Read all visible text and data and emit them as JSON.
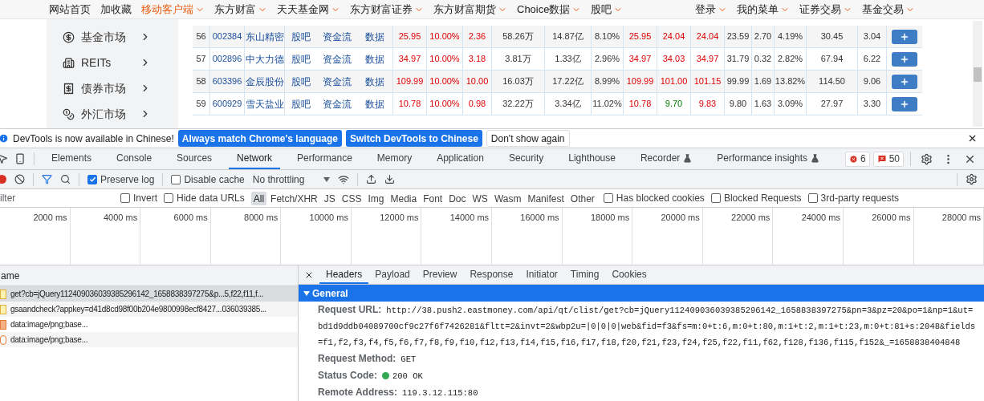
{
  "site_nav": {
    "left": [
      {
        "label": "网站首页",
        "caret": false,
        "highlighted": false
      },
      {
        "label": "加收藏",
        "caret": false,
        "highlighted": false
      },
      {
        "label": "移动客户端",
        "caret": true,
        "highlighted": true
      },
      {
        "label": "东方财富",
        "caret": true,
        "highlighted": false
      },
      {
        "label": "天天基金网",
        "caret": true,
        "highlighted": false
      },
      {
        "label": "东方财富证券",
        "caret": true,
        "highlighted": false
      },
      {
        "label": "东方财富期货",
        "caret": true,
        "highlighted": false
      },
      {
        "label": "Choice数据",
        "caret": true,
        "highlighted": false
      },
      {
        "label": "股吧",
        "caret": true,
        "highlighted": false
      }
    ],
    "right": [
      {
        "label": "登录",
        "caret": true,
        "highlighted": false
      },
      {
        "label": "我的菜单",
        "caret": true,
        "highlighted": false
      },
      {
        "label": "证券交易",
        "caret": true,
        "highlighted": false
      },
      {
        "label": "基金交易",
        "caret": true,
        "highlighted": false
      }
    ]
  },
  "sidebar": {
    "items": [
      {
        "label": "基金市场",
        "kind": "fund"
      },
      {
        "label": "REITs",
        "kind": "building"
      },
      {
        "label": "债券市场",
        "kind": "bond"
      },
      {
        "label": "外汇市场",
        "kind": "forex"
      }
    ]
  },
  "stock_table": {
    "rows": [
      {
        "index": "56",
        "code": "002384",
        "name": "东山精密",
        "links": [
          "股吧",
          "资金流",
          "数据"
        ],
        "cells": [
          {
            "text": "25.95",
            "up": true,
            "down": false
          },
          {
            "text": "10.00%",
            "up": true,
            "down": false
          },
          {
            "text": "2.36",
            "up": true,
            "down": false
          },
          {
            "text": "58.26万",
            "up": false,
            "down": false
          },
          {
            "text": "14.87亿",
            "up": false,
            "down": false
          },
          {
            "text": "8.10%",
            "up": false,
            "down": false
          },
          {
            "text": "25.95",
            "up": true,
            "down": false
          },
          {
            "text": "24.04",
            "up": true,
            "down": false
          },
          {
            "text": "24.04",
            "up": true,
            "down": false
          },
          {
            "text": "23.59",
            "up": false,
            "down": false
          },
          {
            "text": "2.70",
            "up": false,
            "down": false
          },
          {
            "text": "4.19%",
            "up": false,
            "down": false
          },
          {
            "text": "30.45",
            "up": false,
            "down": false
          },
          {
            "text": "3.04",
            "up": false,
            "down": false
          }
        ]
      },
      {
        "index": "57",
        "code": "002896",
        "name": "中大力德",
        "links": [
          "股吧",
          "资金流",
          "数据"
        ],
        "cells": [
          {
            "text": "34.97",
            "up": true,
            "down": false
          },
          {
            "text": "10.00%",
            "up": true,
            "down": false
          },
          {
            "text": "3.18",
            "up": true,
            "down": false
          },
          {
            "text": "3.81万",
            "up": false,
            "down": false
          },
          {
            "text": "1.33亿",
            "up": false,
            "down": false
          },
          {
            "text": "2.96%",
            "up": false,
            "down": false
          },
          {
            "text": "34.97",
            "up": true,
            "down": false
          },
          {
            "text": "34.03",
            "up": true,
            "down": false
          },
          {
            "text": "34.97",
            "up": true,
            "down": false
          },
          {
            "text": "31.79",
            "up": false,
            "down": false
          },
          {
            "text": "0.32",
            "up": false,
            "down": false
          },
          {
            "text": "2.82%",
            "up": false,
            "down": false
          },
          {
            "text": "67.94",
            "up": false,
            "down": false
          },
          {
            "text": "6.22",
            "up": false,
            "down": false
          }
        ]
      },
      {
        "index": "58",
        "code": "603396",
        "name": "金辰股份",
        "links": [
          "股吧",
          "资金流",
          "数据"
        ],
        "cells": [
          {
            "text": "109.99",
            "up": true,
            "down": false
          },
          {
            "text": "10.00%",
            "up": true,
            "down": false
          },
          {
            "text": "10.00",
            "up": true,
            "down": false
          },
          {
            "text": "16.03万",
            "up": false,
            "down": false
          },
          {
            "text": "17.22亿",
            "up": false,
            "down": false
          },
          {
            "text": "8.99%",
            "up": false,
            "down": false
          },
          {
            "text": "109.99",
            "up": true,
            "down": false
          },
          {
            "text": "101.00",
            "up": true,
            "down": false
          },
          {
            "text": "101.15",
            "up": true,
            "down": false
          },
          {
            "text": "99.99",
            "up": false,
            "down": false
          },
          {
            "text": "1.69",
            "up": false,
            "down": false
          },
          {
            "text": "13.82%",
            "up": false,
            "down": false
          },
          {
            "text": "114.50",
            "up": false,
            "down": false
          },
          {
            "text": "9.06",
            "up": false,
            "down": false
          }
        ]
      },
      {
        "index": "59",
        "code": "600929",
        "name": "雪天盐业",
        "links": [
          "股吧",
          "资金流",
          "数据"
        ],
        "cells": [
          {
            "text": "10.78",
            "up": true,
            "down": false
          },
          {
            "text": "10.00%",
            "up": true,
            "down": false
          },
          {
            "text": "0.98",
            "up": true,
            "down": false
          },
          {
            "text": "32.22万",
            "up": false,
            "down": false
          },
          {
            "text": "3.34亿",
            "up": false,
            "down": false
          },
          {
            "text": "11.02%",
            "up": false,
            "down": false
          },
          {
            "text": "10.78",
            "up": true,
            "down": false
          },
          {
            "text": "9.70",
            "up": false,
            "down": true
          },
          {
            "text": "9.83",
            "up": true,
            "down": false
          },
          {
            "text": "9.80",
            "up": false,
            "down": false
          },
          {
            "text": "1.63",
            "up": false,
            "down": false
          },
          {
            "text": "3.09%",
            "up": false,
            "down": false
          },
          {
            "text": "27.97",
            "up": false,
            "down": false
          },
          {
            "text": "3.30",
            "up": false,
            "down": false
          }
        ]
      }
    ]
  },
  "infobar": {
    "message": "DevTools is now available in Chinese!",
    "buttons": [
      {
        "label": "Always match Chrome's language",
        "kind": "primary"
      },
      {
        "label": "Switch DevTools to Chinese",
        "kind": "primary"
      },
      {
        "label": "Don't show again",
        "kind": "secondary"
      }
    ]
  },
  "devtools_tabs": [
    {
      "label": "Elements",
      "selected": false,
      "experimental": false
    },
    {
      "label": "Console",
      "selected": false,
      "experimental": false
    },
    {
      "label": "Sources",
      "selected": false,
      "experimental": false
    },
    {
      "label": "Network",
      "selected": true,
      "experimental": false
    },
    {
      "label": "Performance",
      "selected": false,
      "experimental": false
    },
    {
      "label": "Memory",
      "selected": false,
      "experimental": false
    },
    {
      "label": "Application",
      "selected": false,
      "experimental": false
    },
    {
      "label": "Security",
      "selected": false,
      "experimental": false
    },
    {
      "label": "Lighthouse",
      "selected": false,
      "experimental": false
    },
    {
      "label": "Recorder",
      "selected": false,
      "experimental": true
    },
    {
      "label": "Performance insights",
      "selected": false,
      "experimental": true
    }
  ],
  "issue_counts": {
    "errors": "6",
    "warnings": "50"
  },
  "network_toolbar": {
    "preserve_log": {
      "label": "Preserve log",
      "checked": true
    },
    "disable_cache": {
      "label": "Disable cache",
      "checked": false
    },
    "throttling": "No throttling"
  },
  "filter_bar": {
    "placeholder": "ilter",
    "options_left": [
      {
        "label": "Invert",
        "checked": false
      },
      {
        "label": "Hide data URLs",
        "checked": false
      }
    ],
    "types": [
      {
        "label": "All",
        "selected": true
      },
      {
        "label": "Fetch/XHR",
        "selected": false
      },
      {
        "label": "JS",
        "selected": false
      },
      {
        "label": "CSS",
        "selected": false
      },
      {
        "label": "Img",
        "selected": false
      },
      {
        "label": "Media",
        "selected": false
      },
      {
        "label": "Font",
        "selected": false
      },
      {
        "label": "Doc",
        "selected": false
      },
      {
        "label": "WS",
        "selected": false
      },
      {
        "label": "Wasm",
        "selected": false
      },
      {
        "label": "Manifest",
        "selected": false
      },
      {
        "label": "Other",
        "selected": false
      }
    ],
    "options_right": [
      {
        "label": "Has blocked cookies",
        "checked": false
      },
      {
        "label": "Blocked Requests",
        "checked": false
      },
      {
        "label": "3rd-party requests",
        "checked": false
      }
    ]
  },
  "timeline": {
    "ticks": [
      "2000 ms",
      "4000 ms",
      "6000 ms",
      "8000 ms",
      "10000 ms",
      "12000 ms",
      "14000 ms",
      "16000 ms",
      "18000 ms",
      "20000 ms",
      "22000 ms",
      "24000 ms",
      "26000 ms",
      "28000 ms"
    ]
  },
  "requests": {
    "column": "ame",
    "rows": [
      {
        "name": "get?cb=jQuery112409036039385296142_1658838397275&p...5,f22,f11,f...",
        "kind": "script",
        "selected": true
      },
      {
        "name": "gsaandcheck?appkey=d41d8cd98f00b204e9800998ecf8427...036039385...",
        "kind": "script",
        "selected": false
      },
      {
        "name": "data:image/png;base...",
        "kind": "image",
        "selected": false
      },
      {
        "name": "data:image/png;base...",
        "kind": "svg",
        "selected": false
      }
    ]
  },
  "details": {
    "tabs": [
      {
        "label": "Headers",
        "selected": true
      },
      {
        "label": "Payload",
        "selected": false
      },
      {
        "label": "Preview",
        "selected": false
      },
      {
        "label": "Response",
        "selected": false
      },
      {
        "label": "Initiator",
        "selected": false
      },
      {
        "label": "Timing",
        "selected": false
      },
      {
        "label": "Cookies",
        "selected": false
      }
    ],
    "section": {
      "title": "General",
      "expanded": true,
      "rows": [
        {
          "key": "Request URL:",
          "value": "http://38.push2.eastmoney.com/api/qt/clist/get?cb=jQuery112409036039385296142_1658838397275&pn=3&pz=20&po=1&np=1&ut=bd1d9ddb04089700cf9c27f6f7426281&fltt=2&invt=2&wbp2u=|0|0|0|web&fid=f3&fs=m:0+t:6,m:0+t:80,m:1+t:2,m:1+t:23,m:0+t:81+s:2048&fields=f1,f2,f3,f4,f5,f6,f7,f8,f9,f10,f12,f13,f14,f15,f16,f17,f18,f20,f21,f23,f24,f25,f22,f11,f62,f128,f136,f115,f152&_=1658838404848",
          "ok_indicator": false
        },
        {
          "key": "Request Method:",
          "value": "GET",
          "ok_indicator": false
        },
        {
          "key": "Status Code:",
          "value": "200 OK",
          "ok_indicator": true
        },
        {
          "key": "Remote Address:",
          "value": "119.3.12.115:80",
          "ok_indicator": false
        }
      ]
    }
  }
}
